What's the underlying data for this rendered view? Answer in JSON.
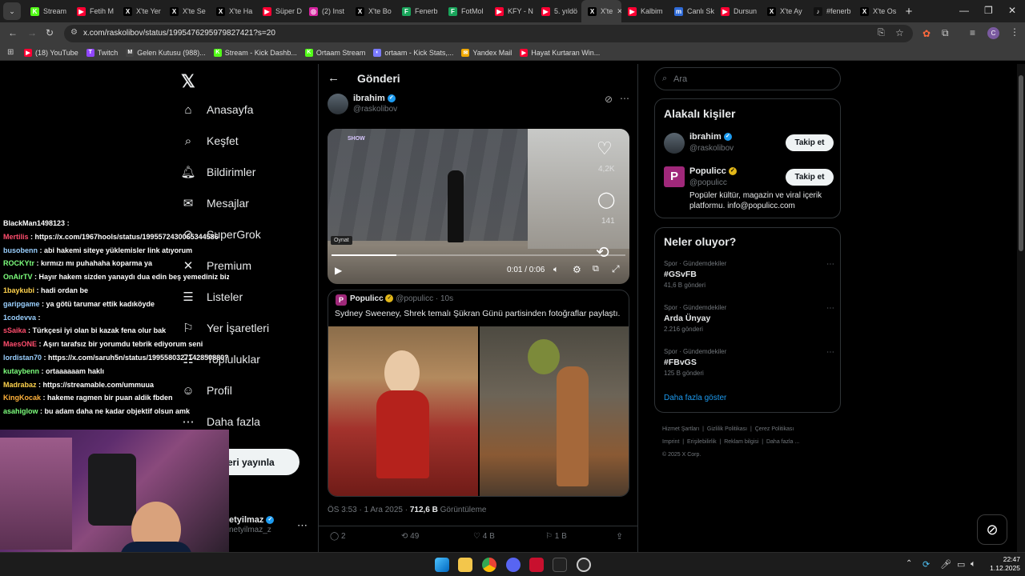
{
  "browser": {
    "tabs": [
      {
        "label": "Stream",
        "color": "#53fc18",
        "glyph": "K"
      },
      {
        "label": "Fetih M",
        "color": "#ff0033",
        "glyph": "▶"
      },
      {
        "label": "X'te Yer",
        "color": "#000000",
        "glyph": "X"
      },
      {
        "label": "X'te Se",
        "color": "#000000",
        "glyph": "X"
      },
      {
        "label": "X'te Ha",
        "color": "#000000",
        "glyph": "X"
      },
      {
        "label": "Süper D",
        "color": "#ff0033",
        "glyph": "▶"
      },
      {
        "label": "(2) Inst",
        "color": "#d6249f",
        "glyph": "◎"
      },
      {
        "label": "X'te Bo",
        "color": "#000000",
        "glyph": "X"
      },
      {
        "label": "Fenerb",
        "color": "#19a55b",
        "glyph": "F"
      },
      {
        "label": "FotMol",
        "color": "#19a55b",
        "glyph": "F"
      },
      {
        "label": "KFY - N",
        "color": "#ff0033",
        "glyph": "▶"
      },
      {
        "label": "5. yıldö",
        "color": "#ff0033",
        "glyph": "▶"
      },
      {
        "label": "X'te",
        "color": "#000000",
        "glyph": "X",
        "active": true
      },
      {
        "label": "Kalbim",
        "color": "#ff0033",
        "glyph": "▶"
      },
      {
        "label": "Canlı Sk",
        "color": "#2f6bd8",
        "glyph": "m"
      },
      {
        "label": "Dursun",
        "color": "#ff0033",
        "glyph": "▶"
      },
      {
        "label": "X'te Ay",
        "color": "#000000",
        "glyph": "X"
      },
      {
        "label": "#fenerb",
        "color": "#111111",
        "glyph": "♪"
      },
      {
        "label": "X'te Os",
        "color": "#000000",
        "glyph": "X"
      }
    ],
    "url": "x.com/raskolibov/status/1995476295979827421?s=20",
    "bookmarks": [
      {
        "label": "(18) YouTube",
        "color": "#ff0033",
        "glyph": "▶"
      },
      {
        "label": "Twitch",
        "color": "#9146ff",
        "glyph": "T"
      },
      {
        "label": "Gelen Kutusu (988)...",
        "color": "#444444",
        "glyph": "M"
      },
      {
        "label": "Stream - Kick Dashb...",
        "color": "#53fc18",
        "glyph": "K"
      },
      {
        "label": "Ortaam Stream",
        "color": "#53fc18",
        "glyph": "K"
      },
      {
        "label": "ortaam - Kick Stats,...",
        "color": "#7a7aff",
        "glyph": "◐"
      },
      {
        "label": "Yandex Mail",
        "color": "#f0a800",
        "glyph": "✉"
      },
      {
        "label": "Hayat Kurtaran Win...",
        "color": "#ff0033",
        "glyph": "▶"
      }
    ]
  },
  "nav": {
    "items": [
      {
        "label": "Anasayfa",
        "icon": "home-icon",
        "glyph": "⌂"
      },
      {
        "label": "Keşfet",
        "icon": "search-icon",
        "glyph": "⌕"
      },
      {
        "label": "Bildirimler",
        "icon": "bell-icon",
        "glyph": "🔔︎"
      },
      {
        "label": "Mesajlar",
        "icon": "mail-icon",
        "glyph": "✉"
      },
      {
        "label": "SuperGrok",
        "icon": "grok-icon",
        "glyph": "⊘"
      },
      {
        "label": "Premium",
        "icon": "x-premium-icon",
        "glyph": "✕"
      },
      {
        "label": "Listeler",
        "icon": "list-icon",
        "glyph": "☰"
      },
      {
        "label": "Yer İşaretleri",
        "icon": "bookmark-icon",
        "glyph": "⚐"
      },
      {
        "label": "Topluluklar",
        "icon": "communities-icon",
        "glyph": "☷"
      },
      {
        "label": "Profil",
        "icon": "profile-icon",
        "glyph": "☺"
      },
      {
        "label": "Daha fazla",
        "icon": "more-icon",
        "glyph": "⋯"
      }
    ],
    "post_button": "eri yayınla",
    "account_name": "etyilmaz",
    "account_handle": "netyilmaz_z"
  },
  "post": {
    "header": "Gönderi",
    "author_name": "ibrahim",
    "author_handle": "@raskolibov",
    "video": {
      "overlay_channel": "SHOW",
      "likes": "4,2K",
      "comments": "141",
      "time": "0:01 / 0:06",
      "tooltip": "Oynat",
      "progress_fraction": 0.22
    },
    "quote": {
      "name": "Populicc",
      "handle": "@populicc",
      "time": "10s",
      "text": "Sydney Sweeney, Shrek temalı Şükran Günü partisinden fotoğraflar paylaştı."
    },
    "meta_time": "ÖS 3:53 · 1 Ara 2025 · ",
    "meta_views": "712,6 B",
    "meta_views_label": " Görüntüleme",
    "actions": {
      "replies": "2",
      "reposts": "49",
      "likes": "4 B",
      "bookmarks": "1 B"
    }
  },
  "sidebar": {
    "search_placeholder": "Ara",
    "related_title": "Alakalı kişiler",
    "related": [
      {
        "name": "ibrahim",
        "handle": "@raskolibov",
        "button": "Takip et",
        "bio": ""
      },
      {
        "name": "Populicc",
        "handle": "@populicc",
        "button": "Takip et",
        "bio": "Popüler kültür, magazin ve viral içerik platformu. info@populicc.com"
      }
    ],
    "trends_title": "Neler oluyor?",
    "trends": [
      {
        "category": "Spor · Gündemdekiler",
        "tag": "#GSvFB",
        "count": "41,6 B gönderi"
      },
      {
        "category": "Spor · Gündemdekiler",
        "tag": "Arda Ünyay",
        "count": "2.216 gönderi"
      },
      {
        "category": "Spor · Gündemdekiler",
        "tag": "#FBvGS",
        "count": "125 B gönderi"
      }
    ],
    "show_more": "Daha fazla göster",
    "footer": [
      "Hizmet Şartları",
      "Gizlilik Politikası",
      "Çerez Politikası",
      "Imprint",
      "Erişilebilirlik",
      "Reklam bilgisi",
      "Daha fazla ...",
      "© 2025 X Corp."
    ]
  },
  "chat": [
    {
      "user": "BlackMan1498123",
      "msg": "",
      "color": "#ffffff"
    },
    {
      "user": "Mertilis",
      "msg": "https://x.com/1967hools/status/1995572430065344586",
      "color": "#ff4d6d"
    },
    {
      "user": "busobenn",
      "msg": "abi hakemi siteye yüklemisler link atıyorum",
      "color": "#9ad0ff"
    },
    {
      "user": "ROCKYtr",
      "msg": "kırmızı mı puhahaha koparma ya",
      "color": "#7dff7d"
    },
    {
      "user": "OnAirTV",
      "msg": "Hayır hakem sizden yanaydı dua edin beş yemediniz bizden",
      "color": "#7dff7d"
    },
    {
      "user": "1baykubi",
      "msg": "hadi ordan be",
      "color": "#ffd34d"
    },
    {
      "user": "garipgame",
      "msg": "ya götü tarumar ettik kadıköyde",
      "color": "#9ad0ff"
    },
    {
      "user": "1codevva",
      "msg": "",
      "color": "#9ad0ff"
    },
    {
      "user": "sSaika",
      "msg": "Türkçesi iyi olan bi kazak fena olur bak",
      "color": "#ff4d6d"
    },
    {
      "user": "MaesONE",
      "msg": "Aşırı tarafsız bir yorumdu tebrik ediyorum seni",
      "color": "#ff4d6d"
    },
    {
      "user": "lordistan70",
      "msg": "https://x.com/saruh5n/status/1995580327142850880?s=20",
      "color": "#9ad0ff"
    },
    {
      "user": "kutaybenn",
      "msg": "ortaaaaaam haklı",
      "color": "#7dff7d"
    },
    {
      "user": "Madrabaz",
      "msg": "https://streamable.com/ummuua",
      "color": "#ffd34d"
    },
    {
      "user": "KingKocak",
      "msg": "hakeme ragmen bir puan aldik fbden",
      "color": "#ffb13b"
    },
    {
      "user": "asahiglow",
      "msg": "bu adam daha ne kadar objektif olsun amk",
      "color": "#7dff7d"
    }
  ],
  "taskbar": {
    "time": "22:47",
    "date": "1.12.2025"
  }
}
